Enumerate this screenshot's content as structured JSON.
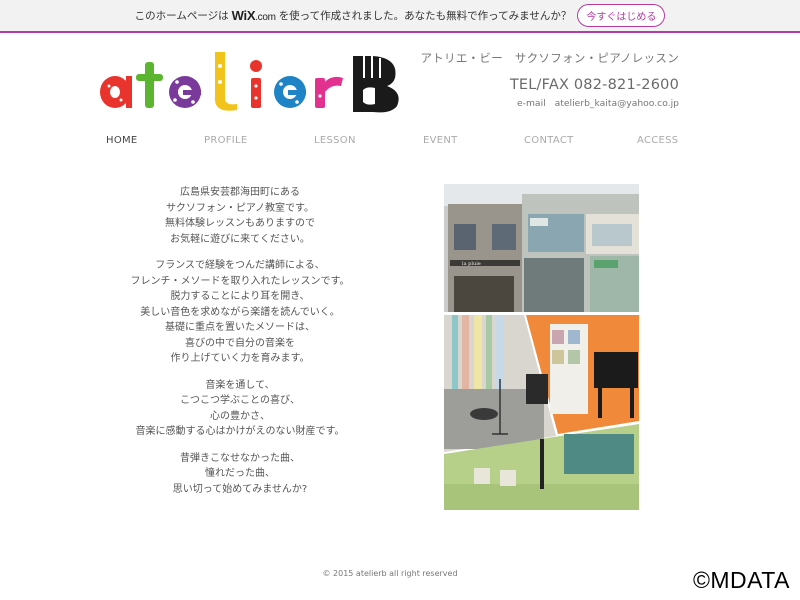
{
  "wix_banner": {
    "message_before": "このホームページは",
    "wix_logo_text": "WiX",
    "wix_logo_suffix": ".com",
    "message_after": "を使って作成されました。あなたも無料で作ってみませんか？",
    "cta_label": "今すぐはじめる",
    "accent_color": "#b43ba3"
  },
  "logo": {
    "text": "atelierB"
  },
  "header": {
    "subtitle": "アトリエ・ビー　サクソフォン・ピアノレッスン",
    "tel": "TEL/FAX 082-821-2600",
    "email_label": "e-mail",
    "email": "atelierb_kaita@yahoo.co.jp"
  },
  "nav": {
    "items": [
      {
        "label": "HOME",
        "active": true
      },
      {
        "label": "PROFILE",
        "active": false
      },
      {
        "label": "LESSON",
        "active": false
      },
      {
        "label": "EVENT",
        "active": false
      },
      {
        "label": "CONTACT",
        "active": false
      },
      {
        "label": "ACCESS",
        "active": false
      }
    ]
  },
  "content": {
    "paragraphs": [
      [
        "広島県安芸郡海田町にある",
        "サクソフォン・ピアノ教室です。",
        "無料体験レッスンもありますので",
        "お気軽に遊びに来てください。"
      ],
      [
        "フランスで経験をつんだ講師による、",
        "フレンチ・メソードを取り入れたレッスンです。",
        "脱力することにより耳を開き、",
        "美しい音色を求めながら楽譜を読んでいく。",
        "基礎に重点を置いたメソードは、",
        "喜びの中で自分の音楽を",
        "作り上げていく力を育みます。"
      ],
      [
        "音楽を通して、",
        "こつこつ学ぶことの喜び、",
        "心の豊かさ、",
        "音楽に感動する心はかけがえのない財産です。"
      ],
      [
        "昔弾きこなせなかった曲、",
        "憧れだった曲、",
        "思い切って始めてみませんか?"
      ]
    ]
  },
  "photos": {
    "storefront_sign": "la pluie"
  },
  "footer": {
    "copyright": "© 2015 atelierb all right reserved"
  },
  "watermark": "©MDATA"
}
